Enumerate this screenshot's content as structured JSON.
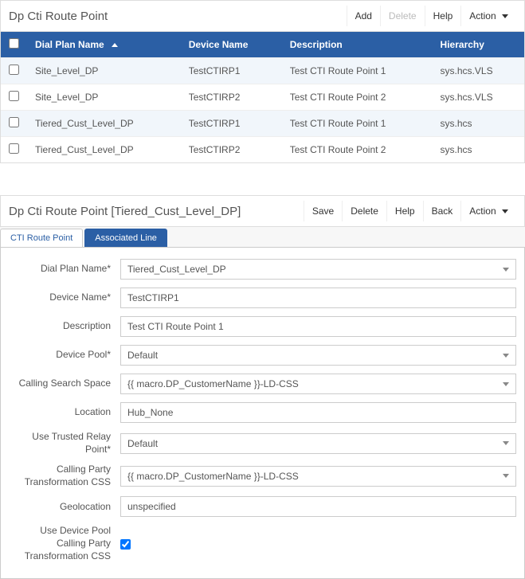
{
  "listPanel": {
    "title": "Dp Cti Route Point",
    "toolbar": {
      "add": "Add",
      "delete": "Delete",
      "help": "Help",
      "action": "Action"
    },
    "columns": {
      "dialPlan": "Dial Plan Name",
      "deviceName": "Device Name",
      "description": "Description",
      "hierarchy": "Hierarchy"
    },
    "rows": [
      {
        "dialPlan": "Site_Level_DP",
        "deviceName": "TestCTIRP1",
        "description": "Test CTI Route Point 1",
        "hierarchy": "sys.hcs.VLS"
      },
      {
        "dialPlan": "Site_Level_DP",
        "deviceName": "TestCTIRP2",
        "description": "Test CTI Route Point 2",
        "hierarchy": "sys.hcs.VLS"
      },
      {
        "dialPlan": "Tiered_Cust_Level_DP",
        "deviceName": "TestCTIRP1",
        "description": "Test CTI Route Point 1",
        "hierarchy": "sys.hcs"
      },
      {
        "dialPlan": "Tiered_Cust_Level_DP",
        "deviceName": "TestCTIRP2",
        "description": "Test CTI Route Point 2",
        "hierarchy": "sys.hcs"
      }
    ]
  },
  "detailPanel": {
    "title": "Dp Cti Route Point [Tiered_Cust_Level_DP]",
    "toolbar": {
      "save": "Save",
      "delete": "Delete",
      "help": "Help",
      "back": "Back",
      "action": "Action"
    },
    "tabs": {
      "routePoint": "CTI Route Point",
      "associatedLine": "Associated Line"
    },
    "form": {
      "labels": {
        "dialPlan": "Dial Plan Name*",
        "deviceName": "Device Name*",
        "description": "Description",
        "devicePool": "Device Pool*",
        "css": "Calling Search Space",
        "location": "Location",
        "trustedRelay": "Use Trusted Relay Point*",
        "callingPartyCss": "Calling Party Transformation CSS",
        "geolocation": "Geolocation",
        "useDevicePool": "Use Device Pool Calling Party Transformation CSS"
      },
      "values": {
        "dialPlan": "Tiered_Cust_Level_DP",
        "deviceName": "TestCTIRP1",
        "description": "Test CTI Route Point 1",
        "devicePool": "Default",
        "css": "{{ macro.DP_CustomerName }}-LD-CSS",
        "location": "Hub_None",
        "trustedRelay": "Default",
        "callingPartyCss": "{{ macro.DP_CustomerName }}-LD-CSS",
        "geolocation": "unspecified",
        "useDevicePool": true
      }
    }
  }
}
